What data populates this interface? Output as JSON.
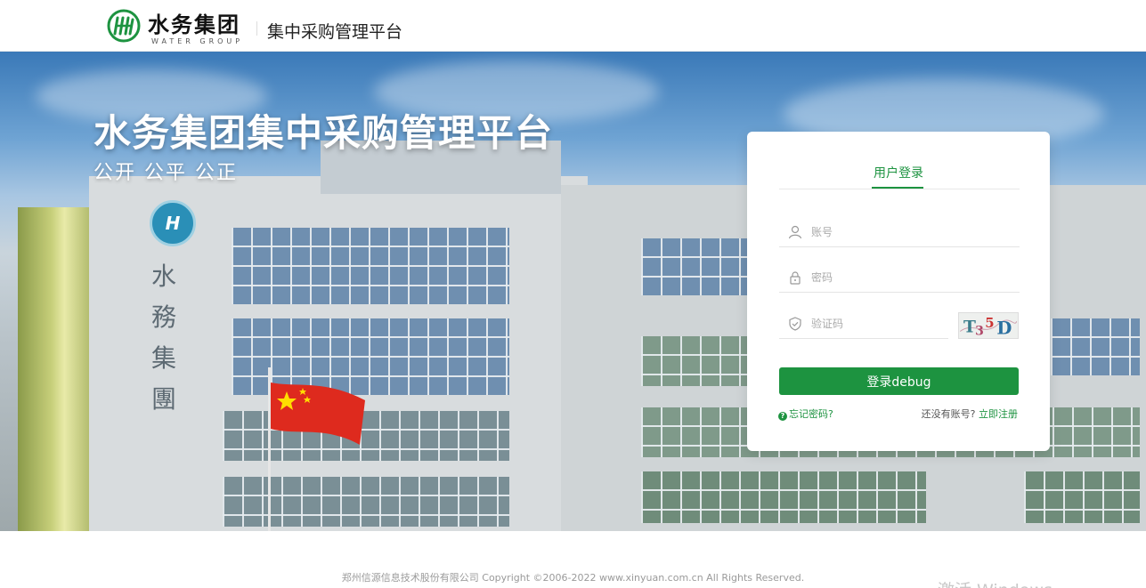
{
  "header": {
    "logo_cn": "水务集团",
    "logo_en": "WATER GROUP",
    "platform_title": "集中采购管理平台"
  },
  "banner": {
    "title": "水务集团集中采购管理平台",
    "subtitle": "公开  公平  公正",
    "building_logo_text": "H",
    "building_sign": [
      "水",
      "務",
      "集",
      "團"
    ]
  },
  "login": {
    "tab_label": "用户登录",
    "username_placeholder": "账号",
    "password_placeholder": "密码",
    "captcha_placeholder": "验证码",
    "captcha_code": "T35D",
    "login_button": "登录debug",
    "forgot_password": "忘记密码?",
    "no_account_text": "还没有账号?",
    "register_link": "立即注册"
  },
  "footer": {
    "copyright": "郑州信源信息技术股份有限公司 Copyright ©2006-2022 www.xinyuan.com.cn All Rights Reserved.",
    "watermark": "激活 Windows"
  },
  "colors": {
    "accent": "#1d9340",
    "card_bg": "#ffffff",
    "sky": "#3a79b8"
  }
}
